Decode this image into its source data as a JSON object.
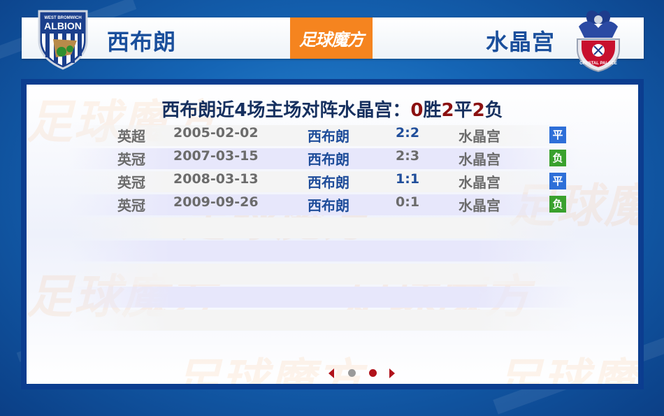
{
  "header": {
    "home_team": "西布朗",
    "away_team": "水晶宫",
    "brand": "足球魔方",
    "home_crest_text": "WEST BROMWICH ALBION",
    "away_crest_text": "CRYSTAL PALACE F.C."
  },
  "panel": {
    "title_prefix": "西布朗近4场主场对阵水晶宫：",
    "wins": "0",
    "wins_label": "胜",
    "draws": "2",
    "draws_label": "平",
    "losses": "2",
    "losses_label": "负",
    "watermark": "足球魔方",
    "matches": [
      {
        "league": "英超",
        "date": "2005-02-02",
        "home": "西布朗",
        "score": "2:2",
        "away": "水晶宫",
        "result": "平",
        "result_color": "#2e6fd8"
      },
      {
        "league": "英冠",
        "date": "2007-03-15",
        "home": "西布朗",
        "score": "2:3",
        "away": "水晶宫",
        "result": "负",
        "result_color": "#3aa12e"
      },
      {
        "league": "英冠",
        "date": "2008-03-13",
        "home": "西布朗",
        "score": "1:1",
        "away": "水晶宫",
        "result": "平",
        "result_color": "#2e6fd8"
      },
      {
        "league": "英冠",
        "date": "2009-09-26",
        "home": "西布朗",
        "score": "0:1",
        "away": "水晶宫",
        "result": "负",
        "result_color": "#3aa12e"
      }
    ]
  },
  "pager": {
    "pages": 2,
    "current": 2
  },
  "colors": {
    "brand_orange": "#f5841f",
    "panel_border": "#0b3d8f",
    "accent_red": "#8b1010",
    "team_blue": "#1a4f9c"
  }
}
